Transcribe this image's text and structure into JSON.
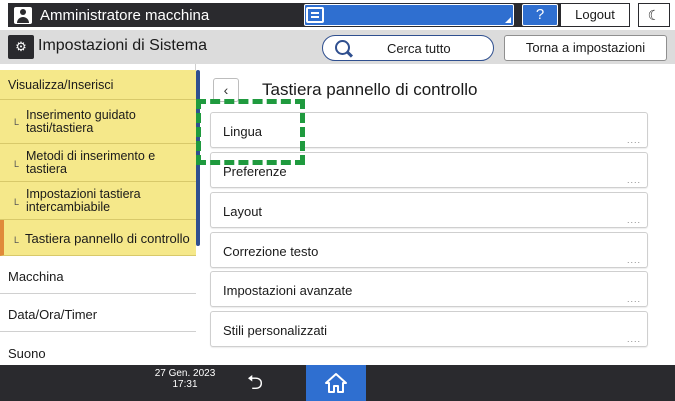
{
  "topbar": {
    "user_label": "Amministratore macchina",
    "help_label": "?",
    "logout_label": "Logout",
    "moon_label": "☾"
  },
  "titlebar": {
    "title": "Impostazioni di Sistema",
    "search_label": "Cerca tutto",
    "back_label": "Torna a impostazioni"
  },
  "sidebar": {
    "items": [
      {
        "label": "Visualizza/Inserisci"
      },
      {
        "label": "Inserimento guidato tasti/tastiera"
      },
      {
        "label": "Metodi di inserimento e tastiera"
      },
      {
        "label": "Impostazioni tastiera intercambiabile"
      },
      {
        "label": "Tastiera pannello di controllo"
      },
      {
        "label": "Macchina"
      },
      {
        "label": "Data/Ora/Timer"
      },
      {
        "label": "Suono"
      }
    ],
    "sub_mark": "L"
  },
  "content": {
    "title": "Tastiera pannello di controllo",
    "back_glyph": "‹",
    "rows": [
      {
        "label": "Lingua"
      },
      {
        "label": "Preferenze"
      },
      {
        "label": "Layout"
      },
      {
        "label": "Correzione testo"
      },
      {
        "label": "Impostazioni avanzate"
      },
      {
        "label": "Stili personalizzati"
      }
    ],
    "row_dots": "...."
  },
  "bottombar": {
    "date": "27 Gen. 2023",
    "time": "17:31"
  },
  "colors": {
    "accent_blue": "#2f6fd0",
    "dark": "#2a2a2e",
    "sidebar_yellow": "#f5e88a",
    "active_orange": "#e08a3a",
    "highlight_green": "#1f9a3e"
  }
}
